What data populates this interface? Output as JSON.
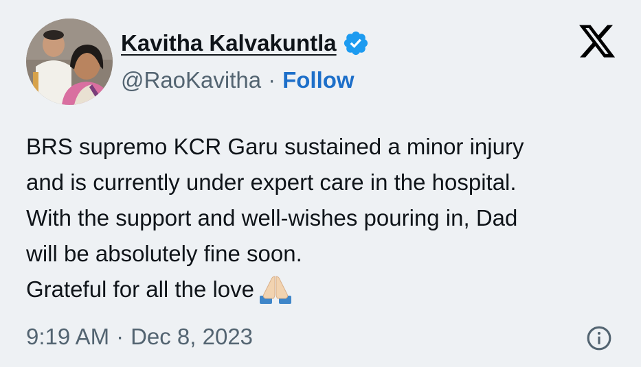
{
  "author": {
    "display_name": "Kavitha Kalvakuntla",
    "handle": "@RaoKavitha",
    "verified": true,
    "avatar": "profile-photo"
  },
  "header": {
    "separator": "·",
    "follow_label": "Follow",
    "logo": "x-logo-icon"
  },
  "tweet": {
    "lines": [
      "BRS supremo KCR Garu sustained a minor injury",
      "and is currently under expert care in the hospital.",
      "With the support and well-wishes pouring in, Dad",
      "will be absolutely fine soon.",
      "Grateful for all the love"
    ],
    "emoji": "folded-hands-icon"
  },
  "footer": {
    "time": "9:19 AM",
    "separator": "·",
    "date": "Dec 8, 2023",
    "info_icon": "info-icon"
  },
  "colors": {
    "background": "#eef1f4",
    "text": "#0f1419",
    "secondary_text": "#536471",
    "link": "#1d6fc9",
    "verified_badge": "#1d9bf0"
  }
}
